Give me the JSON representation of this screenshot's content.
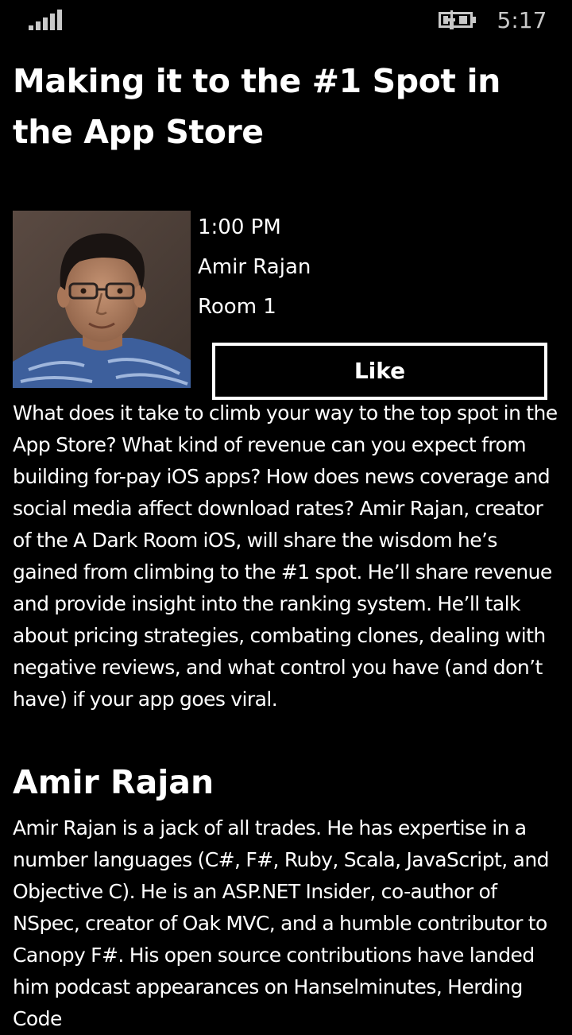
{
  "status_bar": {
    "time": "5:17",
    "signal_icon": "signal-strength-icon",
    "battery_icon": "battery-charging-icon"
  },
  "session": {
    "title": "Making it to the #1 Spot in the App Store",
    "time": "1:00 PM",
    "speaker": "Amir Rajan",
    "room": "Room 1",
    "like_label": "Like",
    "description": "What does it take to climb your way to the top spot in the App Store? What kind of revenue can you expect from building for-pay iOS apps? How does news coverage and social media affect download rates? Amir Rajan, creator of the A Dark Room iOS, will share the wisdom he’s gained from climbing to the #1 spot. He’ll share revenue and provide insight into the ranking system. He’ll talk about pricing strategies, combating clones, dealing with negative reviews, and what control you have (and don’t have) if your app goes viral."
  },
  "speaker_bio": {
    "heading": "Amir Rajan",
    "text": "Amir Rajan is a jack of all trades. He has expertise in a number languages (C#, F#, Ruby, Scala, JavaScript, and Objective C). He is an ASP.NET Insider, co-author of NSpec, creator of Oak MVC, and a humble contributor to Canopy F#. His open source contributions have landed him podcast appearances on Hanselminutes, Herding Code"
  },
  "colors": {
    "background": "#000000",
    "text": "#ffffff",
    "status_text": "#c8c8c8"
  }
}
